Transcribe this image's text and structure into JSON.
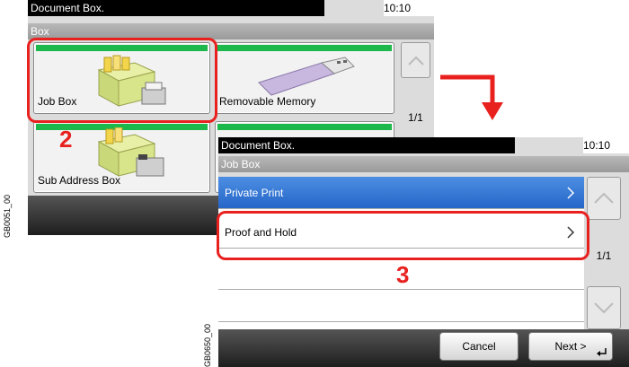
{
  "screen1": {
    "title": "Document Box.",
    "clock": "10:10",
    "subtitle": "Box",
    "tiles": [
      {
        "label": "Job Box"
      },
      {
        "label": "Removable Memory"
      },
      {
        "label": "Sub Address Box"
      },
      {
        "label": ""
      }
    ],
    "page": "1/1",
    "side_code": "GB0051_00"
  },
  "screen2": {
    "title": "Document Box.",
    "clock": "10:10",
    "subtitle": "Job Box",
    "rows": [
      {
        "label": "Private Print"
      },
      {
        "label": "Proof and Hold"
      }
    ],
    "page": "1/1",
    "cancel": "Cancel",
    "next": "Next >",
    "side_code": "GB0650_00"
  },
  "steps": {
    "step2": "2",
    "step3": "3"
  },
  "colors": {
    "accent_red": "#e8211f",
    "highlight_blue": "#2d6fd2",
    "tile_green": "#1db84b"
  }
}
